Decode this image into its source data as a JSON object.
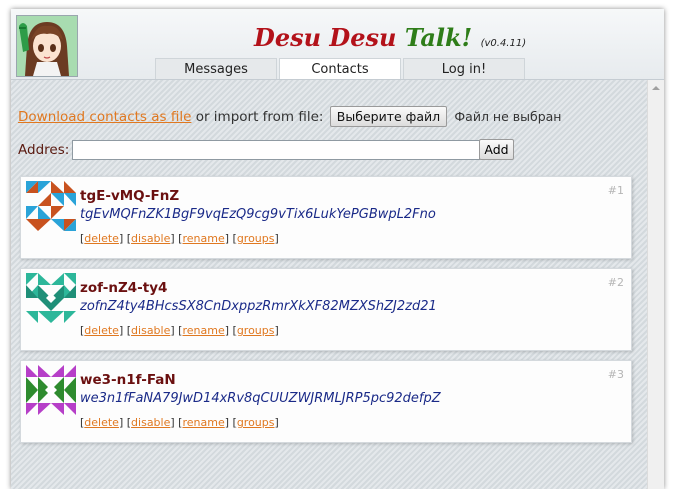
{
  "header": {
    "title_words": [
      "Desu",
      "Desu",
      "Talk!"
    ],
    "version": "(v0.4.11)",
    "tabs": [
      {
        "label": "Messages",
        "active": false
      },
      {
        "label": "Contacts",
        "active": true
      },
      {
        "label": "Log in!",
        "active": false
      }
    ]
  },
  "import_row": {
    "download_link": "Download contacts as file",
    "import_text": "or import from file:",
    "file_button": "Выберите файл",
    "file_status": "Файл не выбран"
  },
  "address": {
    "label": "Addres:",
    "value": "",
    "add_button": "Add"
  },
  "contacts": [
    {
      "number": "#1",
      "nick": "tgE-vMQ-FnZ",
      "key": "tgEvMQFnZK1BgF9vqEzQ9cg9vTix6LukYePGBwpL2Fno",
      "actions": [
        "delete",
        "disable",
        "rename",
        "groups"
      ],
      "identicon_colors": [
        "#c8521f",
        "#2aa3d8"
      ]
    },
    {
      "number": "#2",
      "nick": "zof-nZ4-ty4",
      "key": "zofnZ4ty4BHcsSX8CnDxppzRmrXkXF82MZXShZJ2zd21",
      "actions": [
        "delete",
        "disable",
        "rename",
        "groups"
      ],
      "identicon_colors": [
        "#2db79a",
        "#1f8f78"
      ]
    },
    {
      "number": "#3",
      "nick": "we3-n1f-FaN",
      "key": "we3n1fFaNA79JwD14xRv8qCUUZWJRMLJRP5pc92defpZ",
      "actions": [
        "delete",
        "disable",
        "rename",
        "groups"
      ],
      "identicon_colors": [
        "#b63fc8",
        "#2e8b2e"
      ]
    }
  ],
  "colors": {
    "link": "#e07820",
    "nick": "#6b1010",
    "key": "#1a2a88"
  }
}
